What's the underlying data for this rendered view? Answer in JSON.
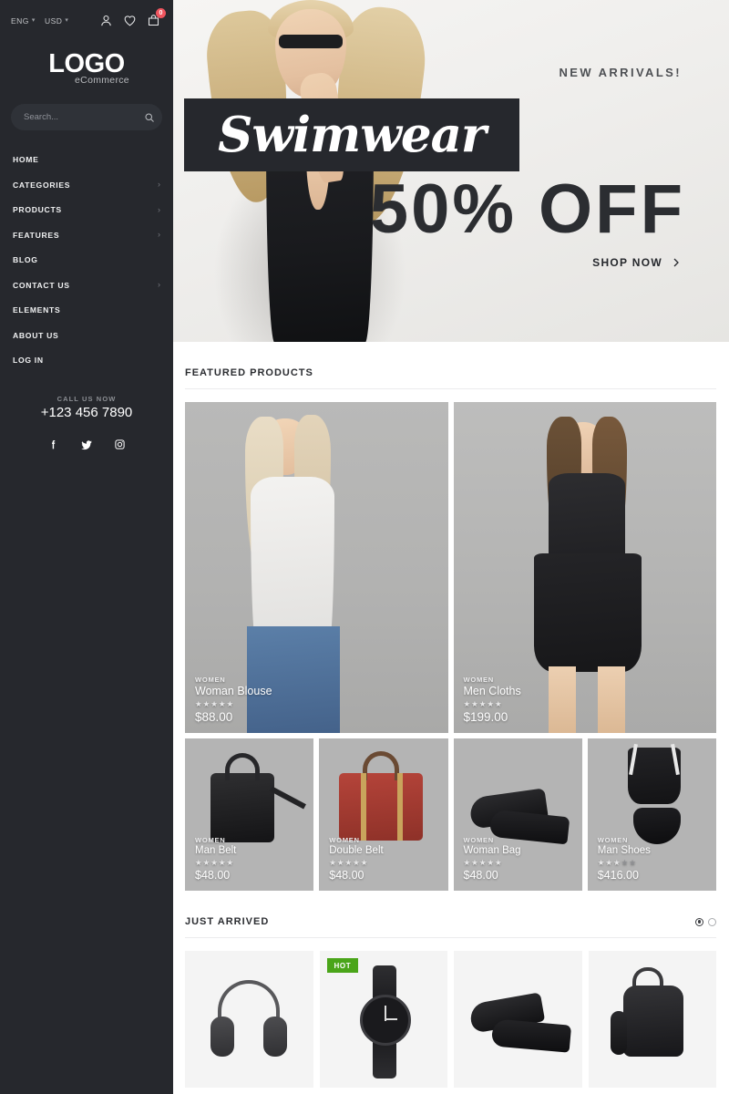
{
  "topbar": {
    "language": "ENG",
    "currency": "USD",
    "account_icon": "user-icon",
    "wishlist_icon": "heart-icon",
    "cart_icon": "bag-icon",
    "cart_count": "0"
  },
  "brand": {
    "name": "LOGO",
    "tagline": "eCommerce"
  },
  "search": {
    "placeholder": "Search...",
    "value": "",
    "icon": "search-icon"
  },
  "nav": [
    {
      "label": "HOME",
      "has_submenu": false
    },
    {
      "label": "CATEGORIES",
      "has_submenu": true
    },
    {
      "label": "PRODUCTS",
      "has_submenu": true
    },
    {
      "label": "FEATURES",
      "has_submenu": true
    },
    {
      "label": "BLOG",
      "has_submenu": false
    },
    {
      "label": "CONTACT US",
      "has_submenu": true
    },
    {
      "label": "ELEMENTS",
      "has_submenu": false
    },
    {
      "label": "ABOUT US",
      "has_submenu": false
    },
    {
      "label": "LOG IN",
      "has_submenu": false
    }
  ],
  "contact": {
    "label": "CALL US NOW",
    "phone": "+123 456 7890"
  },
  "socials": [
    {
      "name": "facebook-icon"
    },
    {
      "name": "twitter-icon"
    },
    {
      "name": "instagram-icon"
    }
  ],
  "hero": {
    "eyebrow": "NEW ARRIVALS!",
    "script_word": "Swimwear",
    "discount": "50% OFF",
    "cta": "SHOP NOW",
    "cta_icon": "chevron-right-icon"
  },
  "featured": {
    "title": "FEATURED PRODUCTS",
    "big": [
      {
        "category": "WOMEN",
        "name": "Woman Blouse",
        "price": "$88.00",
        "rating": 5
      },
      {
        "category": "WOMEN",
        "name": "Men Cloths",
        "price": "$199.00",
        "rating": 5
      }
    ],
    "small": [
      {
        "category": "WOMEN",
        "name": "Man Belt",
        "price": "$48.00",
        "rating": 5
      },
      {
        "category": "WOMEN",
        "name": "Double Belt",
        "price": "$48.00",
        "rating": 5
      },
      {
        "category": "WOMEN",
        "name": "Woman Bag",
        "price": "$48.00",
        "rating": 5
      },
      {
        "category": "WOMEN",
        "name": "Man Shoes",
        "price": "$416.00",
        "rating": 3
      }
    ]
  },
  "just_arrived": {
    "title": "JUST ARRIVED",
    "carousel": {
      "dots": 2,
      "active": 0
    },
    "items": [
      {
        "image": "headphones",
        "badge": ""
      },
      {
        "image": "watch",
        "badge": "HOT"
      },
      {
        "image": "dress-shoes",
        "badge": ""
      },
      {
        "image": "backpack",
        "badge": ""
      }
    ]
  },
  "colors": {
    "sidebar": "#26282d",
    "accent_badge": "#f0555f",
    "hot_badge": "#4aa519",
    "card_bg": "#b4b4b4"
  }
}
